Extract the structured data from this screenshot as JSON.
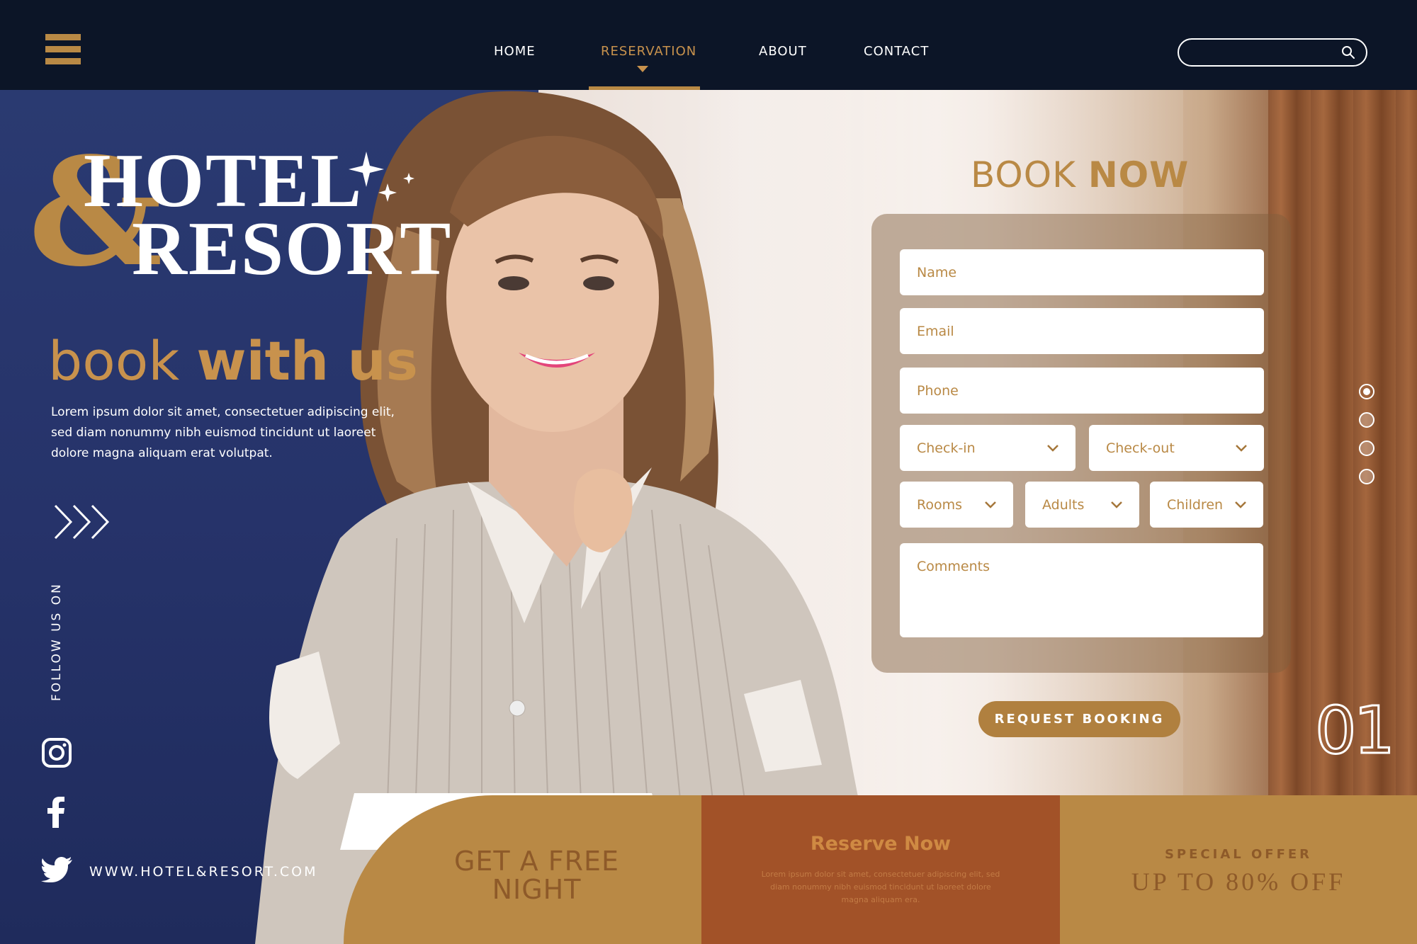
{
  "nav": {
    "items": [
      {
        "label": "HOME"
      },
      {
        "label": "RESERVATION"
      },
      {
        "label": "ABOUT"
      },
      {
        "label": "CONTACT"
      }
    ],
    "active": "RESERVATION",
    "search_placeholder": ""
  },
  "hero": {
    "brand_line1": "HOTEL",
    "brand_ampersand": "&",
    "brand_line2": "RESORT",
    "tagline_light": "book ",
    "tagline_bold": "with us",
    "intro": "Lorem ipsum dolor sit amet, consectetuer adipiscing elit, sed diam nonummy nibh euismod tincidunt ut laoreet dolore magna aliquam erat volutpat."
  },
  "social": {
    "follow_label": "FOLLOW US ON",
    "website": "WWW.HOTEL&RESORT.COM"
  },
  "booking": {
    "title_light": "BOOK ",
    "title_bold": "NOW",
    "name_placeholder": "Name",
    "email_placeholder": "Email",
    "phone_placeholder": "Phone",
    "checkin_label": "Check-in",
    "checkout_label": "Check-out",
    "rooms_label": "Rooms",
    "adults_label": "Adults",
    "children_label": "Children",
    "comments_placeholder": "Comments",
    "submit_label": "REQUEST BOOKING"
  },
  "slider": {
    "count": 4,
    "active_index": 0,
    "number": "01"
  },
  "promos": {
    "free_night_line1": "GET A FREE",
    "free_night_line2": "NIGHT",
    "reserve_title": "Reserve Now",
    "reserve_text": "Lorem ipsum dolor sit amet, consectetuer adipiscing elit, sed diam nonummy nibh euismod tincidunt ut laoreet dolore magna aliquam era.",
    "offer_kicker": "SPECIAL OFFER",
    "offer_title": "UP TO 80% OFF"
  },
  "colors": {
    "gold": "#b98945",
    "navy": "#0c1527",
    "blue_panel": "#2a3a71",
    "rust": "#a25228"
  },
  "icons": {
    "menu": "hamburger-icon",
    "search": "search-icon",
    "instagram": "instagram-icon",
    "facebook": "facebook-icon",
    "twitter": "twitter-icon",
    "chevrons": "triple-chevron-right-icon",
    "dropdown": "chevron-down-icon"
  }
}
